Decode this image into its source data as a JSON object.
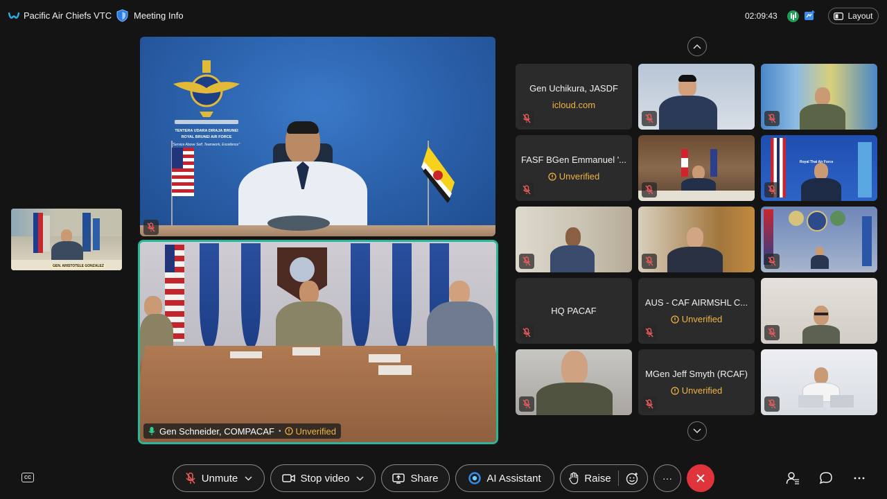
{
  "header": {
    "app_title": "Pacific Air Chiefs VTC",
    "meeting_info_label": "Meeting Info",
    "time": "02:09:43",
    "layout_label": "Layout"
  },
  "self_view": {
    "caption": "GEN. ARISTOTELE GONZALEZ"
  },
  "main_top": {
    "emblem_line1": "TENTERA UDARA DIRAJA BRUNEI",
    "emblem_line2": "ROYAL BRUNEI AIR FORCE",
    "motto": "\"Service Above Self, Teamwork, Excellence\""
  },
  "main_bottom": {
    "name": "Gen Schneider, COMPACAF",
    "separator": "•",
    "status": "Unverified"
  },
  "grid": {
    "tiles": [
      {
        "name": "Gen Uchikura, JASDF",
        "sub": "icloud.com"
      },
      {
        "name": "FASF BGen Emmanuel '...",
        "sub": "Unverified"
      },
      {
        "name": "HQ PACAF"
      },
      {
        "name": "AUS - CAF AIRMSHL C...",
        "sub": "Unverified"
      },
      {
        "name": "MGen Jeff Smyth (RCAF)",
        "sub": "Unverified"
      },
      {
        "banner": "Royal Thai Air Force"
      }
    ]
  },
  "controls": {
    "unmute": "Unmute",
    "stop_video": "Stop video",
    "share": "Share",
    "ai_assistant": "AI Assistant",
    "raise": "Raise",
    "more": "···"
  },
  "colors": {
    "background": "#141414",
    "active_speaker_border": "#2bb59b",
    "unverified": "#f0b442",
    "leave": "#e0343c",
    "mute_icon": "#e85a5a"
  }
}
